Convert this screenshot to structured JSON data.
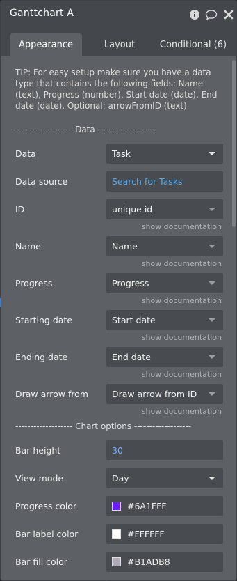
{
  "window": {
    "title": "Ganttchart A"
  },
  "tabs": [
    {
      "label": "Appearance"
    },
    {
      "label": "Layout"
    },
    {
      "label": "Conditional (6)"
    }
  ],
  "tip": "TIP: For easy setup make sure you have a data type that contains the following fields: Name (text), Progress (number), Start date (date), End date (date). Optional: arrowFromID (text)",
  "sections": {
    "data": "------------------- Data -------------------",
    "chart_options": "------------------- Chart options -------------------"
  },
  "show_documentation": "show documentation",
  "fields": {
    "data": {
      "label": "Data",
      "value": "Task"
    },
    "data_source": {
      "label": "Data source",
      "value": "Search for Tasks"
    },
    "id": {
      "label": "ID",
      "value": "unique id"
    },
    "name": {
      "label": "Name",
      "value": "Name"
    },
    "progress": {
      "label": "Progress",
      "value": "Progress"
    },
    "starting_date": {
      "label": "Starting date",
      "value": "Start date"
    },
    "ending_date": {
      "label": "Ending date",
      "value": "End date"
    },
    "draw_arrow_from": {
      "label": "Draw arrow from",
      "value": "Draw arrow from ID"
    },
    "bar_height": {
      "label": "Bar height",
      "value": "30"
    },
    "view_mode": {
      "label": "View mode",
      "value": "Day"
    },
    "progress_color": {
      "label": "Progress color",
      "value": "#6A1FFF",
      "swatch": "#6A1FFF"
    },
    "bar_label_color": {
      "label": "Bar label color",
      "value": "#FFFFFF",
      "swatch": "#FFFFFF"
    },
    "bar_fill_color": {
      "label": "Bar fill color",
      "value": "#B1ADB8",
      "swatch": "#B1ADB8"
    }
  },
  "icons": [
    "info-icon",
    "comment-icon",
    "close-icon",
    "dropdown-caret-icon"
  ]
}
